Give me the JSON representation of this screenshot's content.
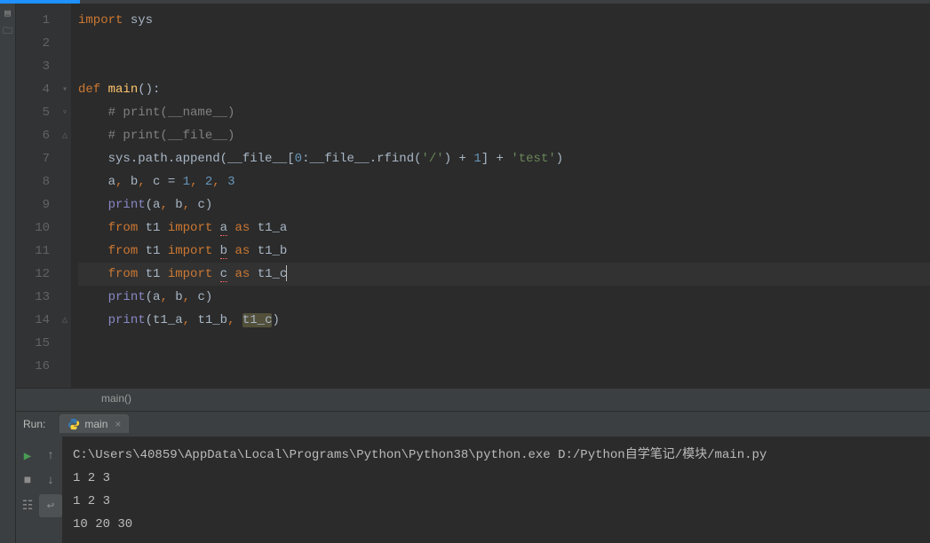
{
  "editor": {
    "lines": [
      {
        "n": 1,
        "tokens": [
          {
            "t": "import ",
            "c": "kw"
          },
          {
            "t": "sys",
            "c": "id"
          }
        ]
      },
      {
        "n": 2,
        "tokens": []
      },
      {
        "n": 3,
        "tokens": []
      },
      {
        "n": 4,
        "fold": "▾",
        "tokens": [
          {
            "t": "def ",
            "c": "kw"
          },
          {
            "t": "main",
            "c": "fn"
          },
          {
            "t": "():",
            "c": "op"
          }
        ]
      },
      {
        "n": 5,
        "fold": "▿",
        "tokens": [
          {
            "t": "    ",
            "c": "op"
          },
          {
            "t": "# print(__name__)",
            "c": "cmt"
          }
        ]
      },
      {
        "n": 6,
        "fold": "△",
        "tokens": [
          {
            "t": "    ",
            "c": "op"
          },
          {
            "t": "# print(__file__)",
            "c": "cmt"
          }
        ]
      },
      {
        "n": 7,
        "tokens": [
          {
            "t": "    sys.path.append(",
            "c": "id"
          },
          {
            "t": "__file__",
            "c": "id"
          },
          {
            "t": "[",
            "c": "op"
          },
          {
            "t": "0",
            "c": "num"
          },
          {
            "t": ":",
            "c": "op"
          },
          {
            "t": "__file__",
            "c": "id"
          },
          {
            "t": ".rfind(",
            "c": "id"
          },
          {
            "t": "'/'",
            "c": "str"
          },
          {
            "t": ") + ",
            "c": "op"
          },
          {
            "t": "1",
            "c": "num"
          },
          {
            "t": "] + ",
            "c": "op"
          },
          {
            "t": "'test'",
            "c": "str"
          },
          {
            "t": ")",
            "c": "op"
          }
        ]
      },
      {
        "n": 8,
        "tokens": [
          {
            "t": "    a",
            "c": "id"
          },
          {
            "t": ", ",
            "c": "kw"
          },
          {
            "t": "b",
            "c": "id"
          },
          {
            "t": ", ",
            "c": "kw"
          },
          {
            "t": "c = ",
            "c": "id"
          },
          {
            "t": "1",
            "c": "num"
          },
          {
            "t": ", ",
            "c": "kw"
          },
          {
            "t": "2",
            "c": "num"
          },
          {
            "t": ", ",
            "c": "kw"
          },
          {
            "t": "3",
            "c": "num"
          }
        ]
      },
      {
        "n": 9,
        "tokens": [
          {
            "t": "    ",
            "c": "op"
          },
          {
            "t": "print",
            "c": "builtin"
          },
          {
            "t": "(a",
            "c": "id"
          },
          {
            "t": ", ",
            "c": "kw"
          },
          {
            "t": "b",
            "c": "id"
          },
          {
            "t": ", ",
            "c": "kw"
          },
          {
            "t": "c)",
            "c": "id"
          }
        ]
      },
      {
        "n": 10,
        "tokens": [
          {
            "t": "    ",
            "c": "op"
          },
          {
            "t": "from ",
            "c": "kw"
          },
          {
            "t": "t1 ",
            "c": "id"
          },
          {
            "t": "import ",
            "c": "kw"
          },
          {
            "t": "a",
            "c": "id underline-err"
          },
          {
            "t": " ",
            "c": "op"
          },
          {
            "t": "as ",
            "c": "kw"
          },
          {
            "t": "t1_a",
            "c": "id"
          }
        ]
      },
      {
        "n": 11,
        "tokens": [
          {
            "t": "    ",
            "c": "op"
          },
          {
            "t": "from ",
            "c": "kw"
          },
          {
            "t": "t1 ",
            "c": "id"
          },
          {
            "t": "import ",
            "c": "kw"
          },
          {
            "t": "b",
            "c": "id underline-err"
          },
          {
            "t": " ",
            "c": "op"
          },
          {
            "t": "as ",
            "c": "kw"
          },
          {
            "t": "t1_b",
            "c": "id"
          }
        ]
      },
      {
        "n": 12,
        "current": true,
        "tokens": [
          {
            "t": "    ",
            "c": "op"
          },
          {
            "t": "from ",
            "c": "kw"
          },
          {
            "t": "t1 ",
            "c": "id"
          },
          {
            "t": "import ",
            "c": "kw"
          },
          {
            "t": "c",
            "c": "id underline-err"
          },
          {
            "t": " ",
            "c": "op"
          },
          {
            "t": "as ",
            "c": "kw"
          },
          {
            "t": "t1_c",
            "c": "id"
          }
        ]
      },
      {
        "n": 13,
        "tokens": [
          {
            "t": "    ",
            "c": "op"
          },
          {
            "t": "print",
            "c": "builtin"
          },
          {
            "t": "(a",
            "c": "id"
          },
          {
            "t": ", ",
            "c": "kw"
          },
          {
            "t": "b",
            "c": "id"
          },
          {
            "t": ", ",
            "c": "kw"
          },
          {
            "t": "c)",
            "c": "id"
          }
        ]
      },
      {
        "n": 14,
        "fold": "△",
        "tokens": [
          {
            "t": "    ",
            "c": "op"
          },
          {
            "t": "print",
            "c": "builtin"
          },
          {
            "t": "(t1_a",
            "c": "id"
          },
          {
            "t": ", ",
            "c": "kw"
          },
          {
            "t": "t1_b",
            "c": "id"
          },
          {
            "t": ", ",
            "c": "kw"
          },
          {
            "t": "t1_c",
            "c": "id warn"
          },
          {
            "t": ")",
            "c": "id"
          }
        ]
      },
      {
        "n": 15,
        "tokens": []
      },
      {
        "n": 16,
        "tokens": []
      }
    ],
    "caret_line": 12
  },
  "breadcrumb": "main()",
  "run": {
    "label": "Run:",
    "tab_name": "main",
    "output": [
      "C:\\Users\\40859\\AppData\\Local\\Programs\\Python\\Python38\\python.exe D:/Python自学笔记/模块/main.py",
      "1 2 3",
      "1 2 3",
      "10 20 30"
    ]
  }
}
